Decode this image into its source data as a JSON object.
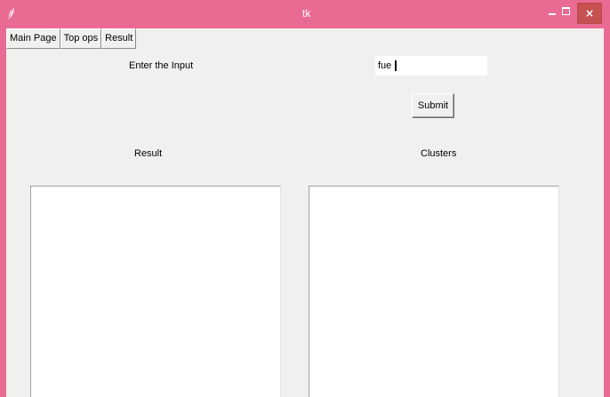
{
  "window": {
    "title": "tk",
    "frame_color": "#e96b93",
    "client_color": "#f0f0f0",
    "close_color": "#c75050",
    "controls": {
      "minimize_icon": "minimize-icon",
      "maximize_icon": "maximize-icon",
      "close_icon": "close-icon",
      "close_glyph": "×"
    },
    "app_icon": "feather-icon"
  },
  "tabs": [
    {
      "label": "Main Page"
    },
    {
      "label": "Top ops"
    },
    {
      "label": "Result"
    }
  ],
  "form": {
    "input_label": "Enter the Input",
    "input_value": "fue",
    "submit_label": "Submit"
  },
  "panels": {
    "result_label": "Result",
    "clusters_label": "Clusters"
  }
}
